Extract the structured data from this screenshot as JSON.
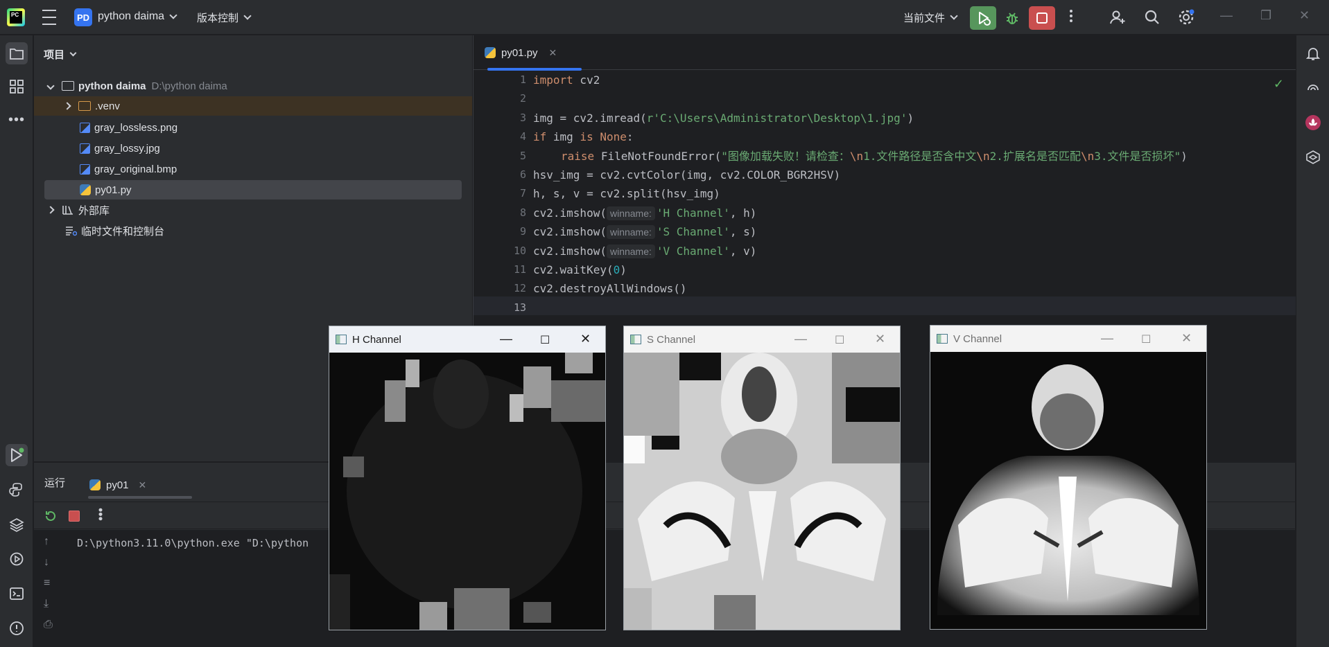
{
  "titlebar": {
    "logo_text": "PC",
    "project_badge": "PD",
    "project_name": "python daima",
    "vcs_label": "版本控制",
    "run_config": "当前文件"
  },
  "project_panel": {
    "title": "项目",
    "root_name": "python daima",
    "root_path": "D:\\python daima",
    "items": [
      {
        "label": ".venv"
      },
      {
        "label": "gray_lossless.png"
      },
      {
        "label": "gray_lossy.jpg"
      },
      {
        "label": "gray_original.bmp"
      },
      {
        "label": "py01.py"
      },
      {
        "label": "外部库"
      },
      {
        "label": "临时文件和控制台"
      }
    ]
  },
  "editor": {
    "tab_label": "py01.py",
    "line_numbers": [
      "1",
      "2",
      "3",
      "4",
      "5",
      "6",
      "7",
      "8",
      "9",
      "10",
      "11",
      "12",
      "13"
    ],
    "hint": "winname:",
    "code": {
      "l1_kw": "import",
      "l1_rest": " cv2",
      "l3_a": "img = cv2.imread(",
      "l3_str": "r'C:\\Users\\Administrator\\Desktop\\1.jpg'",
      "l3_b": ")",
      "l4_kw1": "if",
      "l4_a": " img ",
      "l4_kw2": "is",
      "l4_kw3": " None",
      "l4_b": ":",
      "l5_kw": "raise",
      "l5_cls": "FileNotFoundError",
      "l5_p": "(",
      "l5_s1": "\"图像加载失败！请检查：",
      "l5_e1": "\\n",
      "l5_s2": "1.文件路径是否含中文",
      "l5_e2": "\\n",
      "l5_s3": "2.扩展名是否匹配",
      "l5_e3": "\\n",
      "l5_s4": "3.文件是否损坏\"",
      "l5_end": ")",
      "l6": "hsv_img = cv2.cvtColor(img, cv2.COLOR_BGR2HSV)",
      "l7": "h, s, v = cv2.split(hsv_img)",
      "l8_a": "cv2.imshow(",
      "l8_str": "'H Channel'",
      "l8_b": ", h)",
      "l9_a": "cv2.imshow(",
      "l9_str": "'S Channel'",
      "l9_b": ", s)",
      "l10_a": "cv2.imshow(",
      "l10_str": "'V Channel'",
      "l10_b": ", v)",
      "l11_a": "cv2.waitKey(",
      "l11_num": "0",
      "l11_b": ")",
      "l12": "cv2.destroyAllWindows()"
    }
  },
  "run_panel": {
    "title": "运行",
    "tab_label": "py01",
    "console_text": "D:\\python3.11.0\\python.exe \"D:\\python"
  },
  "cv_windows": [
    {
      "title": "H Channel"
    },
    {
      "title": "S Channel"
    },
    {
      "title": "V Channel"
    }
  ],
  "colors": {
    "run_green": "#57965c",
    "stop_red": "#c94f4f",
    "accent_blue": "#3574f0"
  }
}
